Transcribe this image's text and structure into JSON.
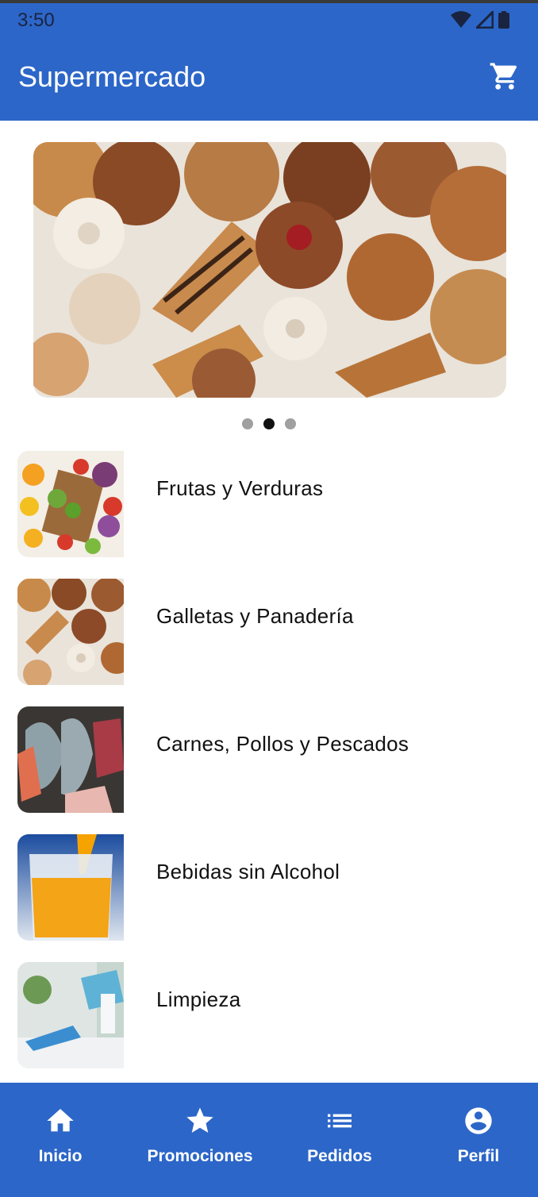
{
  "status_bar": {
    "time": "3:50"
  },
  "app_bar": {
    "title": "Supermercado",
    "cart_icon": "shopping-cart-icon"
  },
  "carousel": {
    "page_count": 3,
    "active_index": 1
  },
  "categories": [
    {
      "label": "Frutas y Verduras",
      "image": "fruits-vegetables"
    },
    {
      "label": "Galletas y Panadería",
      "image": "bakery"
    },
    {
      "label": "Carnes, Pollos y Pescados",
      "image": "meat-fish"
    },
    {
      "label": "Bebidas sin Alcohol",
      "image": "orange-juice"
    },
    {
      "label": "Limpieza",
      "image": "cleaning"
    }
  ],
  "bottom_nav": [
    {
      "label": "Inicio",
      "icon": "home-icon"
    },
    {
      "label": "Promociones",
      "icon": "star-icon"
    },
    {
      "label": "Pedidos",
      "icon": "list-icon"
    },
    {
      "label": "Perfil",
      "icon": "account-circle-icon"
    }
  ],
  "colors": {
    "primary": "#2c66c8",
    "dot_inactive": "#a0a0a0",
    "dot_active": "#111111"
  }
}
